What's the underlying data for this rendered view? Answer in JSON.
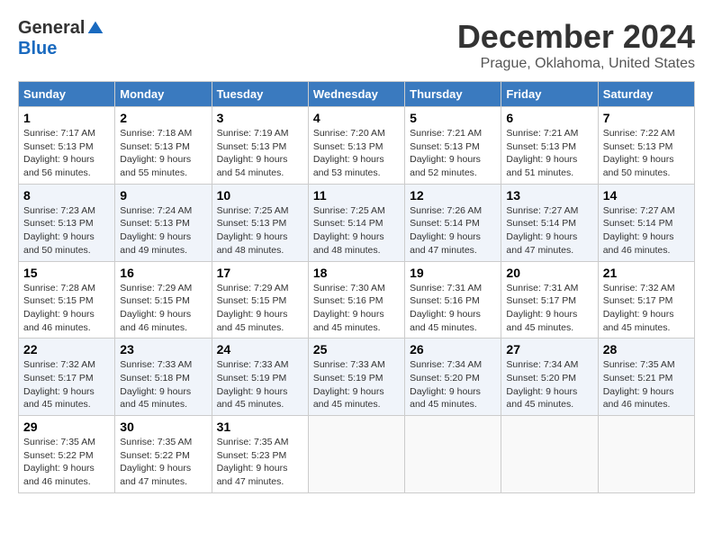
{
  "header": {
    "logo_general": "General",
    "logo_blue": "Blue",
    "title": "December 2024",
    "subtitle": "Prague, Oklahoma, United States"
  },
  "calendar": {
    "days_of_week": [
      "Sunday",
      "Monday",
      "Tuesday",
      "Wednesday",
      "Thursday",
      "Friday",
      "Saturday"
    ],
    "weeks": [
      [
        {
          "day": "1",
          "sunrise": "Sunrise: 7:17 AM",
          "sunset": "Sunset: 5:13 PM",
          "daylight": "Daylight: 9 hours and 56 minutes."
        },
        {
          "day": "2",
          "sunrise": "Sunrise: 7:18 AM",
          "sunset": "Sunset: 5:13 PM",
          "daylight": "Daylight: 9 hours and 55 minutes."
        },
        {
          "day": "3",
          "sunrise": "Sunrise: 7:19 AM",
          "sunset": "Sunset: 5:13 PM",
          "daylight": "Daylight: 9 hours and 54 minutes."
        },
        {
          "day": "4",
          "sunrise": "Sunrise: 7:20 AM",
          "sunset": "Sunset: 5:13 PM",
          "daylight": "Daylight: 9 hours and 53 minutes."
        },
        {
          "day": "5",
          "sunrise": "Sunrise: 7:21 AM",
          "sunset": "Sunset: 5:13 PM",
          "daylight": "Daylight: 9 hours and 52 minutes."
        },
        {
          "day": "6",
          "sunrise": "Sunrise: 7:21 AM",
          "sunset": "Sunset: 5:13 PM",
          "daylight": "Daylight: 9 hours and 51 minutes."
        },
        {
          "day": "7",
          "sunrise": "Sunrise: 7:22 AM",
          "sunset": "Sunset: 5:13 PM",
          "daylight": "Daylight: 9 hours and 50 minutes."
        }
      ],
      [
        {
          "day": "8",
          "sunrise": "Sunrise: 7:23 AM",
          "sunset": "Sunset: 5:13 PM",
          "daylight": "Daylight: 9 hours and 50 minutes."
        },
        {
          "day": "9",
          "sunrise": "Sunrise: 7:24 AM",
          "sunset": "Sunset: 5:13 PM",
          "daylight": "Daylight: 9 hours and 49 minutes."
        },
        {
          "day": "10",
          "sunrise": "Sunrise: 7:25 AM",
          "sunset": "Sunset: 5:13 PM",
          "daylight": "Daylight: 9 hours and 48 minutes."
        },
        {
          "day": "11",
          "sunrise": "Sunrise: 7:25 AM",
          "sunset": "Sunset: 5:14 PM",
          "daylight": "Daylight: 9 hours and 48 minutes."
        },
        {
          "day": "12",
          "sunrise": "Sunrise: 7:26 AM",
          "sunset": "Sunset: 5:14 PM",
          "daylight": "Daylight: 9 hours and 47 minutes."
        },
        {
          "day": "13",
          "sunrise": "Sunrise: 7:27 AM",
          "sunset": "Sunset: 5:14 PM",
          "daylight": "Daylight: 9 hours and 47 minutes."
        },
        {
          "day": "14",
          "sunrise": "Sunrise: 7:27 AM",
          "sunset": "Sunset: 5:14 PM",
          "daylight": "Daylight: 9 hours and 46 minutes."
        }
      ],
      [
        {
          "day": "15",
          "sunrise": "Sunrise: 7:28 AM",
          "sunset": "Sunset: 5:15 PM",
          "daylight": "Daylight: 9 hours and 46 minutes."
        },
        {
          "day": "16",
          "sunrise": "Sunrise: 7:29 AM",
          "sunset": "Sunset: 5:15 PM",
          "daylight": "Daylight: 9 hours and 46 minutes."
        },
        {
          "day": "17",
          "sunrise": "Sunrise: 7:29 AM",
          "sunset": "Sunset: 5:15 PM",
          "daylight": "Daylight: 9 hours and 45 minutes."
        },
        {
          "day": "18",
          "sunrise": "Sunrise: 7:30 AM",
          "sunset": "Sunset: 5:16 PM",
          "daylight": "Daylight: 9 hours and 45 minutes."
        },
        {
          "day": "19",
          "sunrise": "Sunrise: 7:31 AM",
          "sunset": "Sunset: 5:16 PM",
          "daylight": "Daylight: 9 hours and 45 minutes."
        },
        {
          "day": "20",
          "sunrise": "Sunrise: 7:31 AM",
          "sunset": "Sunset: 5:17 PM",
          "daylight": "Daylight: 9 hours and 45 minutes."
        },
        {
          "day": "21",
          "sunrise": "Sunrise: 7:32 AM",
          "sunset": "Sunset: 5:17 PM",
          "daylight": "Daylight: 9 hours and 45 minutes."
        }
      ],
      [
        {
          "day": "22",
          "sunrise": "Sunrise: 7:32 AM",
          "sunset": "Sunset: 5:17 PM",
          "daylight": "Daylight: 9 hours and 45 minutes."
        },
        {
          "day": "23",
          "sunrise": "Sunrise: 7:33 AM",
          "sunset": "Sunset: 5:18 PM",
          "daylight": "Daylight: 9 hours and 45 minutes."
        },
        {
          "day": "24",
          "sunrise": "Sunrise: 7:33 AM",
          "sunset": "Sunset: 5:19 PM",
          "daylight": "Daylight: 9 hours and 45 minutes."
        },
        {
          "day": "25",
          "sunrise": "Sunrise: 7:33 AM",
          "sunset": "Sunset: 5:19 PM",
          "daylight": "Daylight: 9 hours and 45 minutes."
        },
        {
          "day": "26",
          "sunrise": "Sunrise: 7:34 AM",
          "sunset": "Sunset: 5:20 PM",
          "daylight": "Daylight: 9 hours and 45 minutes."
        },
        {
          "day": "27",
          "sunrise": "Sunrise: 7:34 AM",
          "sunset": "Sunset: 5:20 PM",
          "daylight": "Daylight: 9 hours and 45 minutes."
        },
        {
          "day": "28",
          "sunrise": "Sunrise: 7:35 AM",
          "sunset": "Sunset: 5:21 PM",
          "daylight": "Daylight: 9 hours and 46 minutes."
        }
      ],
      [
        {
          "day": "29",
          "sunrise": "Sunrise: 7:35 AM",
          "sunset": "Sunset: 5:22 PM",
          "daylight": "Daylight: 9 hours and 46 minutes."
        },
        {
          "day": "30",
          "sunrise": "Sunrise: 7:35 AM",
          "sunset": "Sunset: 5:22 PM",
          "daylight": "Daylight: 9 hours and 47 minutes."
        },
        {
          "day": "31",
          "sunrise": "Sunrise: 7:35 AM",
          "sunset": "Sunset: 5:23 PM",
          "daylight": "Daylight: 9 hours and 47 minutes."
        },
        null,
        null,
        null,
        null
      ]
    ]
  }
}
